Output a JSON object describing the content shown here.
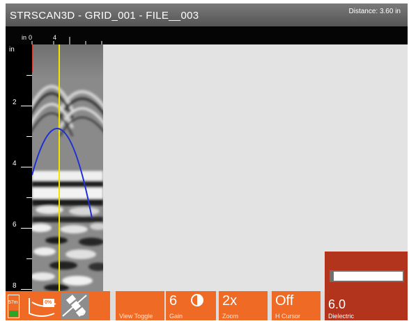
{
  "app": {
    "title": "STRSCAN3D - GRID_001 - FILE__003",
    "distance": "Distance: 3.60 in"
  },
  "ruler": {
    "unit_label": "in",
    "ticks": [
      "0",
      "4"
    ]
  },
  "depth_scale": {
    "unit_label": "in",
    "labels": [
      "2",
      "4",
      "6",
      "8"
    ]
  },
  "status": {
    "battery_label": "57m",
    "storage_label": "0%"
  },
  "toolbar": {
    "view_toggle_label": "View Toggle",
    "gain": {
      "value": "6",
      "label": "Gain"
    },
    "zoom": {
      "value": "2x",
      "label": "Zoom"
    },
    "h_cursor": {
      "value": "Off",
      "label": "H Cursor"
    },
    "dielectric": {
      "value": "6.0",
      "label": "Dielectric"
    }
  },
  "colors": {
    "accent": "#ef6a24",
    "dielectric_panel": "#b3341c",
    "cursor": "#f2e600",
    "hyperbola": "#1f2fd6"
  }
}
